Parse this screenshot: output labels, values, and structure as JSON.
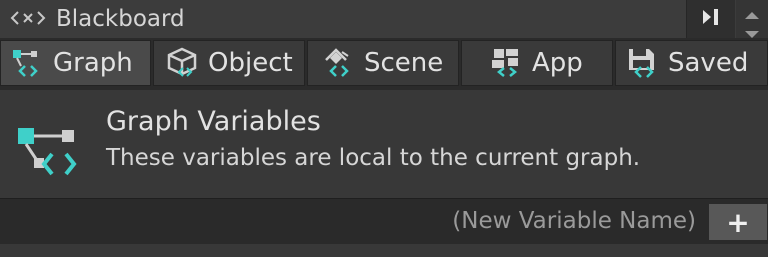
{
  "window": {
    "title": "Blackboard",
    "title_icon": "code-brackets-icon",
    "dock_icon": "panel-toggle-icon"
  },
  "tabs": [
    {
      "label": "Graph",
      "icon": "graph-node-icon",
      "active": true
    },
    {
      "label": "Object",
      "icon": "cube-icon",
      "active": false
    },
    {
      "label": "Scene",
      "icon": "scene-icon",
      "active": false
    },
    {
      "label": "App",
      "icon": "app-blocks-icon",
      "active": false
    },
    {
      "label": "Saved",
      "icon": "floppy-disk-icon",
      "active": false
    }
  ],
  "info": {
    "title": "Graph Variables",
    "description": "These variables are local to the current graph.",
    "icon": "graph-node-icon"
  },
  "new_variable": {
    "placeholder": "(New Variable Name)",
    "add_label": "+"
  },
  "colors": {
    "accent": "#3fd0c9",
    "background": "#383838",
    "tab_active": "#4a4a4a"
  }
}
